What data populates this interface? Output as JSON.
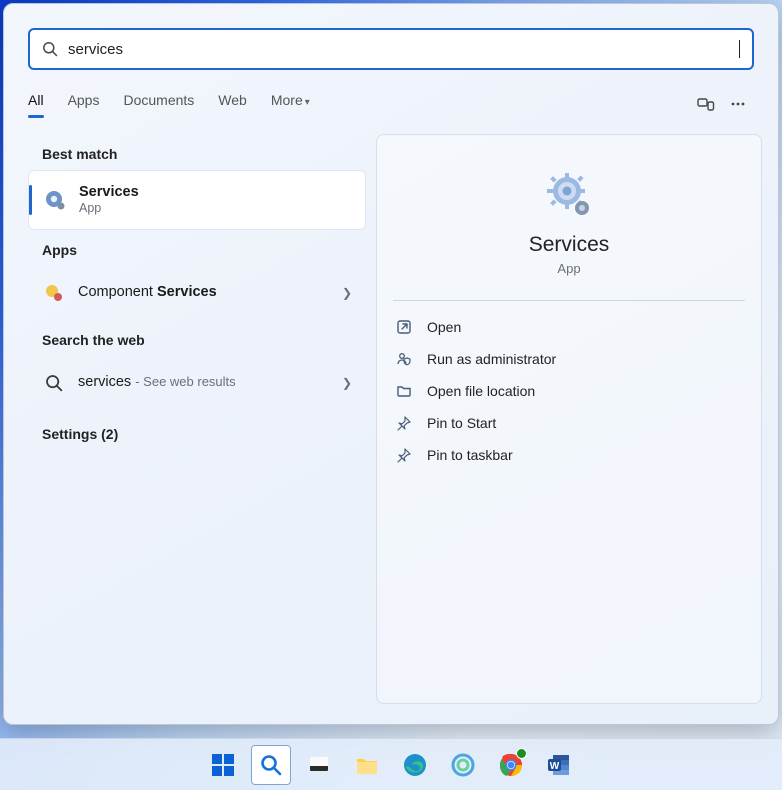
{
  "search": {
    "value": "services"
  },
  "tabs": {
    "all": "All",
    "apps": "Apps",
    "documents": "Documents",
    "web": "Web",
    "more": "More"
  },
  "sections": {
    "best_match": "Best match",
    "apps": "Apps",
    "search_web": "Search the web",
    "settings_label": "Settings (2)"
  },
  "results": {
    "best": {
      "title": "Services",
      "subtitle": "App"
    },
    "component": {
      "prefix": "Component ",
      "match": "Services"
    },
    "web": {
      "query": "services",
      "suffix": "See web results"
    }
  },
  "detail": {
    "title": "Services",
    "subtitle": "App",
    "actions": {
      "open": "Open",
      "run_admin": "Run as administrator",
      "open_loc": "Open file location",
      "pin_start": "Pin to Start",
      "pin_taskbar": "Pin to taskbar"
    }
  }
}
